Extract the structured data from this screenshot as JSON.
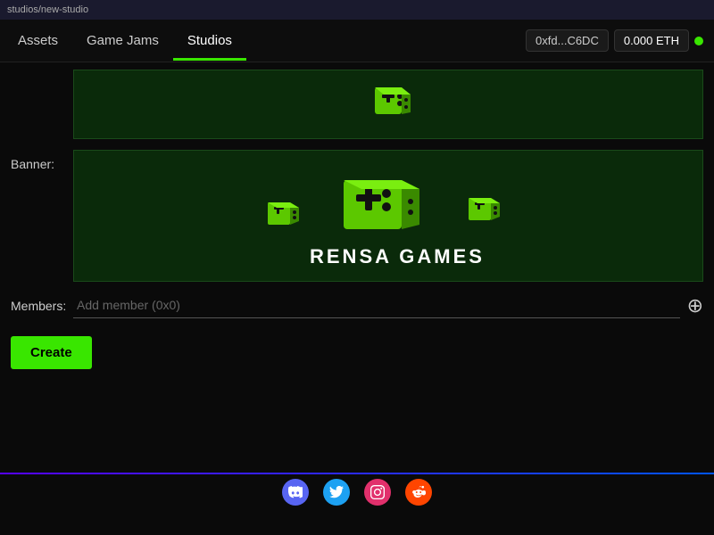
{
  "titleBar": {
    "text": "studios/new-studio"
  },
  "nav": {
    "items": [
      {
        "label": "Assets",
        "active": false
      },
      {
        "label": "Game Jams",
        "active": false
      },
      {
        "label": "Studios",
        "active": true
      }
    ],
    "wallet": {
      "address": "0xfd...C6DC",
      "balance": "0.000 ETH"
    }
  },
  "form": {
    "membersLabel": "Members:",
    "membersPlaceholder": "Add member (0x0)",
    "createButton": "Create"
  },
  "labels": {
    "bannerLabel": "Banner:"
  },
  "footer": {
    "socials": [
      {
        "name": "Discord",
        "class": "discord-icon",
        "symbol": "D"
      },
      {
        "name": "Twitter",
        "class": "twitter-icon",
        "symbol": "t"
      },
      {
        "name": "Instagram",
        "class": "instagram-icon",
        "symbol": "▣"
      },
      {
        "name": "Reddit",
        "class": "reddit-icon",
        "symbol": "r"
      }
    ]
  }
}
